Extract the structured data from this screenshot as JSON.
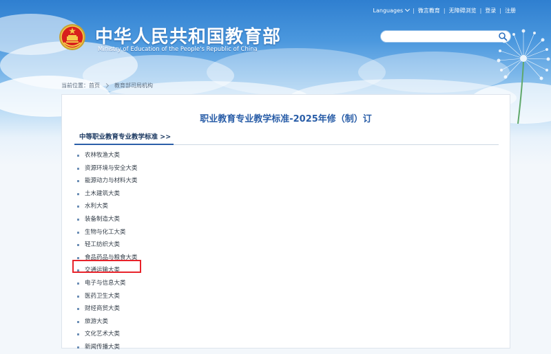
{
  "header": {
    "title": "中华人民共和国教育部",
    "subtitle": "Ministry of Education of the People's Republic of China",
    "top_nav": [
      {
        "label": "Languages"
      },
      {
        "label": "微言教育"
      },
      {
        "label": "无障碍浏览"
      },
      {
        "label": "登录"
      },
      {
        "label": "注册"
      }
    ],
    "search": {
      "placeholder": "",
      "value": ""
    }
  },
  "breadcrumb": {
    "prefix": "当前位置：",
    "home": "首页",
    "current": "教育部司局机构"
  },
  "main": {
    "title": "职业教育专业教学标准-2025年修（制）订",
    "section_title": "中等职业教育专业教学标准 >>",
    "categories": [
      "农林牧渔大类",
      "资源环境与安全大类",
      "能源动力与材料大类",
      "土木建筑大类",
      "水利大类",
      "装备制造大类",
      "生物与化工大类",
      "轻工纺织大类",
      "食品药品与粮食大类",
      "交通运输大类",
      "电子与信息大类",
      "医药卫生大类",
      "财经商贸大类",
      "旅游大类",
      "文化艺术大类",
      "新闻传播大类"
    ],
    "highlighted_category": "交通运输大类"
  },
  "colors": {
    "accent": "#2a5ea8",
    "highlight": "#e8222a",
    "header_blue": "#2f7fd0"
  },
  "icons": [
    "national-emblem-icon",
    "search-icon",
    "chevron-down-icon",
    "chevron-right-icon",
    "bullet-icon"
  ]
}
